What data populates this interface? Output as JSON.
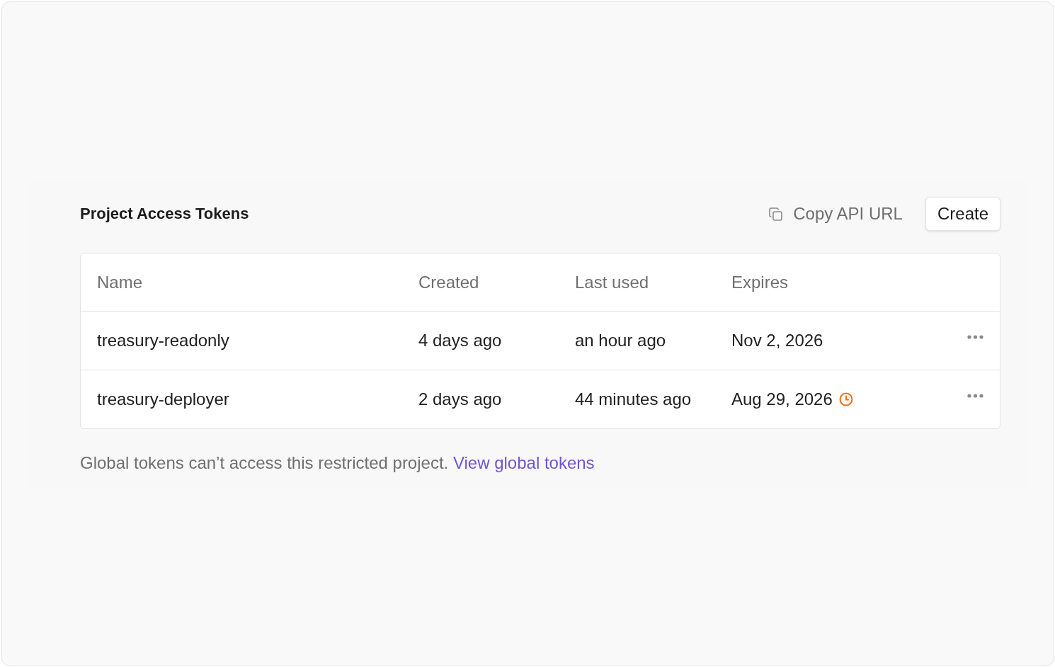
{
  "section": {
    "title": "Project Access Tokens",
    "copy_link": {
      "label": "Copy API URL"
    },
    "create_button": {
      "label": "Create"
    }
  },
  "table": {
    "columns": [
      "Name",
      "Created",
      "Last used",
      "Expires"
    ],
    "rows": [
      {
        "name": "treasury-readonly",
        "created": "4 days ago",
        "last_used": "an hour ago",
        "expires": "Nov 2, 2026",
        "expiring_soon": false
      },
      {
        "name": "treasury-deployer",
        "created": "2 days ago",
        "last_used": "44 minutes ago",
        "expires": "Aug 29, 2026",
        "expiring_soon": true
      }
    ]
  },
  "footer": {
    "text": "Global tokens can’t access this restricted project.",
    "link": "View global tokens"
  }
}
